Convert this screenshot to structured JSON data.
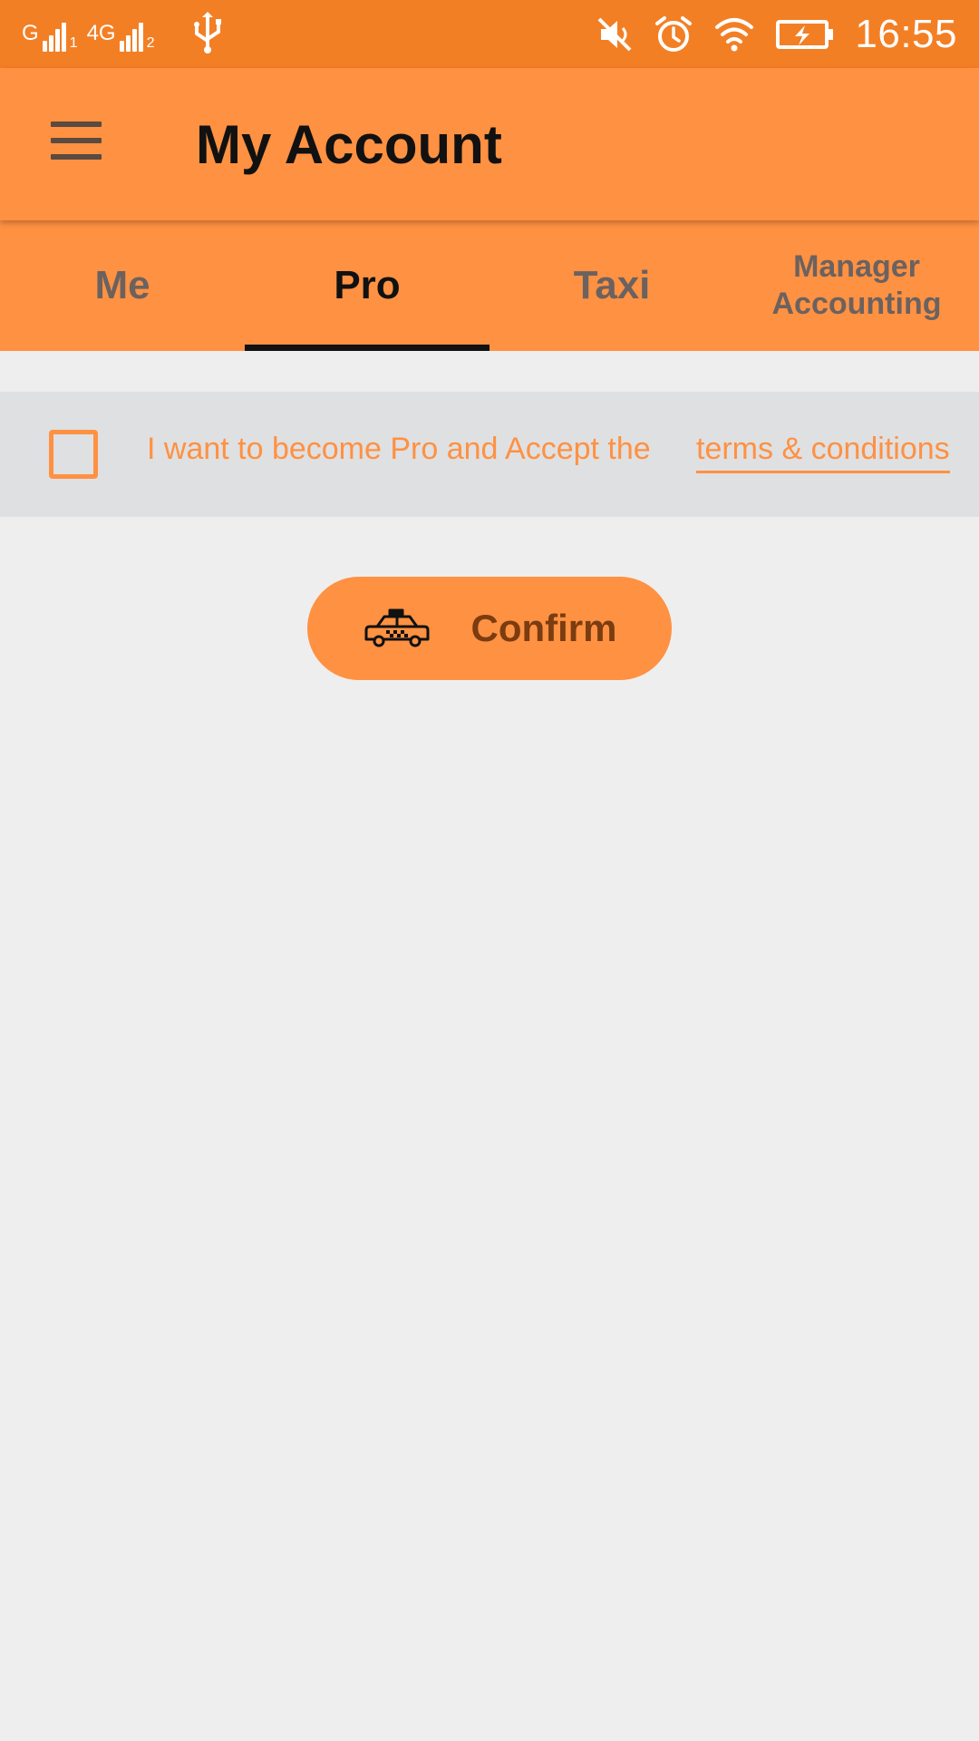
{
  "status_bar": {
    "sim1_label": "G",
    "sim1_sub": "1",
    "sim2_label": "4G",
    "sim2_sub": "2",
    "time": "16:55"
  },
  "app_bar": {
    "title": "My Account"
  },
  "tabs": [
    {
      "label": "Me",
      "active": false
    },
    {
      "label": "Pro",
      "active": true
    },
    {
      "label": "Taxi",
      "active": false
    },
    {
      "label": "Manager Accounting",
      "active": false
    }
  ],
  "terms": {
    "text": "I want to become Pro and Accept the",
    "link": "terms & conditions",
    "checked": false
  },
  "confirm_button": {
    "label": "Confirm"
  },
  "colors": {
    "status_bar": "#f37f25",
    "accent": "#ff9142",
    "background": "#eeeeee"
  },
  "icons": [
    "menu-icon",
    "usb-icon",
    "mute-icon",
    "alarm-icon",
    "wifi-icon",
    "battery-charging-icon",
    "taxi-icon"
  ]
}
